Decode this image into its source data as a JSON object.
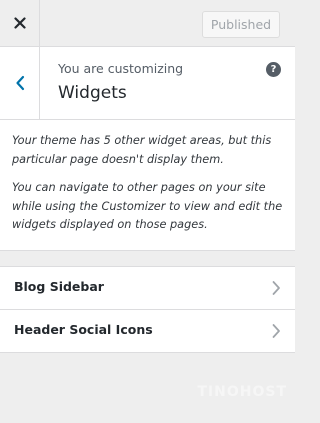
{
  "topbar": {
    "close_icon": "close-icon",
    "publish_label": "Published"
  },
  "section": {
    "customizing_label": "You are customizing",
    "title": "Widgets",
    "back_icon": "chevron-left-icon",
    "help_icon": "help-icon",
    "help_glyph": "?"
  },
  "description": {
    "paragraphs": [
      "Your theme has 5 other widget areas, but this particular page doesn't display them.",
      "You can navigate to other pages on your site while using the Customizer to view and edit the widgets displayed on those pages."
    ]
  },
  "widget_areas": [
    {
      "label": "Blog Sidebar"
    },
    {
      "label": "Header Social Icons"
    }
  ],
  "watermark": {
    "text": "TINOHOST"
  },
  "colors": {
    "accent": "#0073aa",
    "background": "#eeeeee",
    "panel": "#ffffff",
    "border": "#dcdcde"
  }
}
